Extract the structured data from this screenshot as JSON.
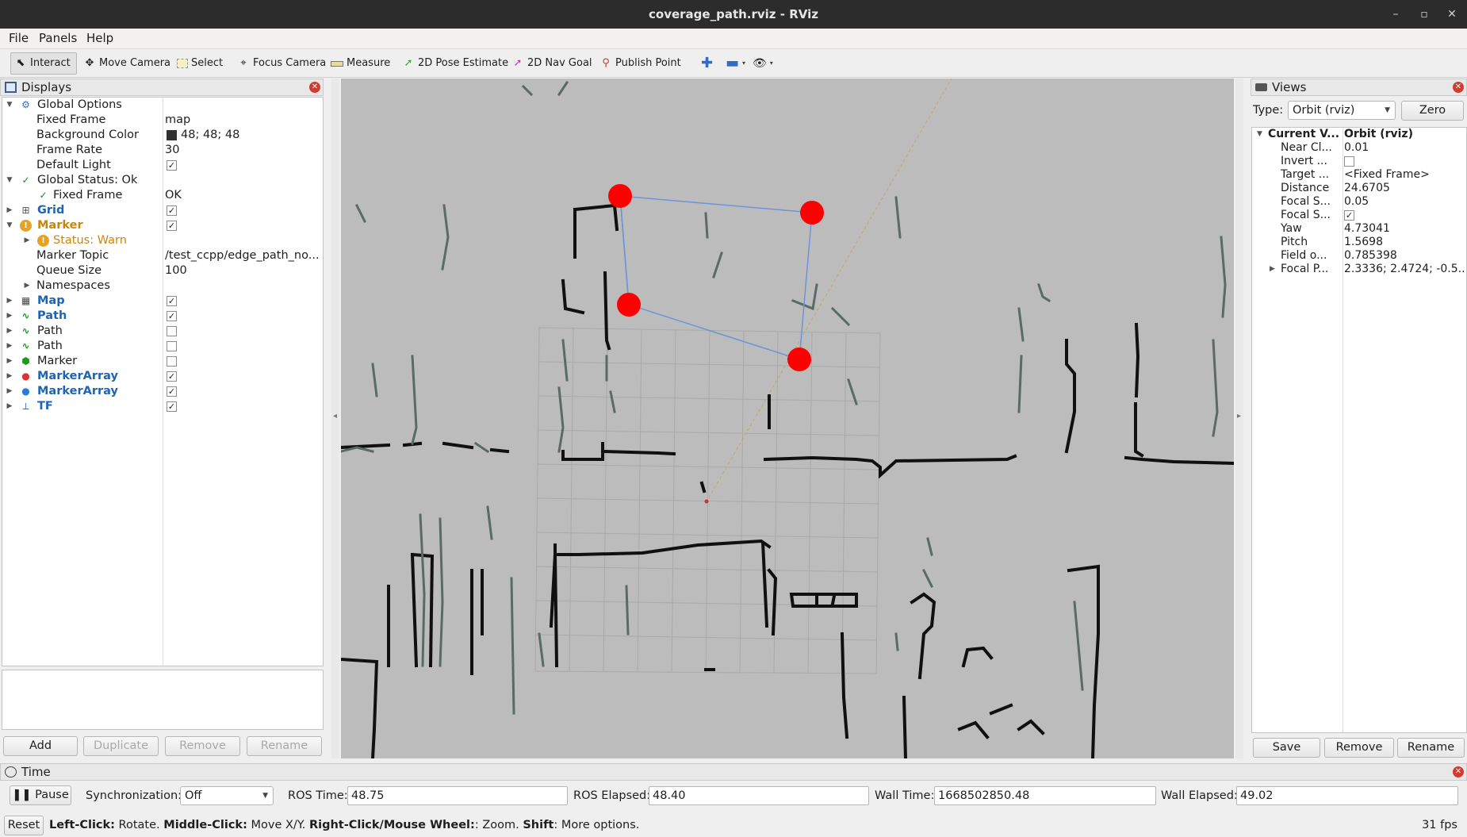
{
  "window": {
    "title": "coverage_path.rviz - RViz",
    "controls": [
      "–",
      "▫",
      "✕"
    ]
  },
  "menu": [
    "File",
    "Panels",
    "Help"
  ],
  "toolbar": {
    "tools": [
      "Interact",
      "Move Camera",
      "Select",
      "Focus Camera",
      "Measure",
      "2D Pose Estimate",
      "2D Nav Goal",
      "Publish Point"
    ]
  },
  "displays": {
    "title": "Displays",
    "rows": [
      {
        "label": "Global Options",
        "value": ""
      },
      {
        "label": "Fixed Frame",
        "value": "map"
      },
      {
        "label": "Background Color",
        "value": "48; 48; 48"
      },
      {
        "label": "Frame Rate",
        "value": "30"
      },
      {
        "label": "Default Light",
        "value": ""
      },
      {
        "label": "Global Status: Ok",
        "value": ""
      },
      {
        "label": "Fixed Frame",
        "value": "OK"
      },
      {
        "label": "Grid",
        "value": ""
      },
      {
        "label": "Marker",
        "value": ""
      },
      {
        "label": "Status: Warn",
        "value": ""
      },
      {
        "label": "Marker Topic",
        "value": "/test_ccpp/edge_path_no..."
      },
      {
        "label": "Queue Size",
        "value": "100"
      },
      {
        "label": "Namespaces",
        "value": ""
      },
      {
        "label": "Map",
        "value": ""
      },
      {
        "label": "Path",
        "value": ""
      },
      {
        "label": "Path",
        "value": ""
      },
      {
        "label": "Path",
        "value": ""
      },
      {
        "label": "Marker",
        "value": ""
      },
      {
        "label": "MarkerArray",
        "value": ""
      },
      {
        "label": "MarkerArray",
        "value": ""
      },
      {
        "label": "TF",
        "value": ""
      }
    ],
    "buttons": [
      "Add",
      "Duplicate",
      "Remove",
      "Rename"
    ]
  },
  "views": {
    "title": "Views",
    "type_label": "Type:",
    "type_value": "Orbit (rviz)",
    "zero": "Zero",
    "header": {
      "label": "Current V...",
      "value": "Orbit (rviz)"
    },
    "rows": [
      {
        "label": "Near Cl...",
        "value": "0.01"
      },
      {
        "label": "Invert ...",
        "value": ""
      },
      {
        "label": "Target ...",
        "value": "<Fixed Frame>"
      },
      {
        "label": "Distance",
        "value": "24.6705"
      },
      {
        "label": "Focal S...",
        "value": "0.05"
      },
      {
        "label": "Focal S...",
        "value": ""
      },
      {
        "label": "Yaw",
        "value": "4.73041"
      },
      {
        "label": "Pitch",
        "value": "1.5698"
      },
      {
        "label": "Field o...",
        "value": "0.785398"
      },
      {
        "label": "Focal P...",
        "value": "2.3336; 2.4724; -0.5..."
      }
    ],
    "buttons": [
      "Save",
      "Remove",
      "Rename"
    ]
  },
  "time": {
    "title": "Time",
    "pause": "Pause",
    "sync_label": "Synchronization:",
    "sync_value": "Off",
    "ros_time_label": "ROS Time:",
    "ros_time": "48.75",
    "ros_elapsed_label": "ROS Elapsed:",
    "ros_elapsed": "48.40",
    "wall_time_label": "Wall Time:",
    "wall_time": "1668502850.48",
    "wall_elapsed_label": "Wall Elapsed:",
    "wall_elapsed": "49.02"
  },
  "status": {
    "reset": "Reset",
    "k1": "Left-Click:",
    "v1": " Rotate. ",
    "k2": "Middle-Click:",
    "v2": " Move X/Y. ",
    "k3": "Right-Click/Mouse Wheel:",
    "v3": ": Zoom. ",
    "k4": "Shift",
    "v4": ": More options.",
    "fps": "31 fps"
  },
  "colors": {
    "marker": "#ff0000",
    "path_line": "#6e93d6",
    "map_bg": "#bcbcbc",
    "warn": "#c9860d",
    "link_blue": "#1f63b5"
  }
}
